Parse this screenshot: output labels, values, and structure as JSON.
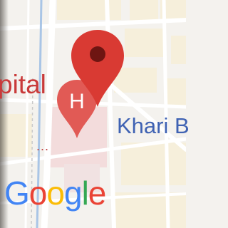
{
  "map": {
    "labels": {
      "hospital_partial": "pital",
      "area_partial": "Khari B",
      "more_marker": "..."
    },
    "markers": {
      "selected_pin": "red-location-pin-icon",
      "hospital_pin": "hospital-pin-icon",
      "hospital_letter": "H"
    },
    "colors": {
      "pin_red": "#d93a33",
      "pin_dot": "#6e1512",
      "hospital_red": "#e15a55",
      "area_label_blue": "#3f62b3",
      "road": "#ffffff",
      "water_blue": "#a9c5e6",
      "block_yellow": "#f5ecd3"
    }
  },
  "branding": {
    "logo_text": "Google",
    "letters": [
      "G",
      "o",
      "o",
      "g",
      "l",
      "e"
    ],
    "letter_colors": [
      "#4285f4",
      "#ea4335",
      "#fbbc05",
      "#4285f4",
      "#34a853",
      "#ea4335"
    ]
  }
}
